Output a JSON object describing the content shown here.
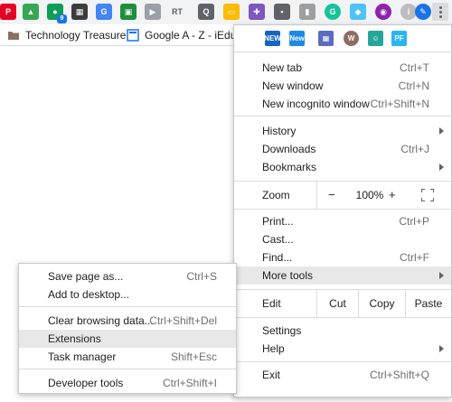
{
  "toolbar": {
    "extensions": [
      {
        "icon": "pinterest-icon",
        "color": "#e60023",
        "glyph": "P"
      },
      {
        "icon": "google-drive-icon",
        "color": "#34a853",
        "glyph": "▲"
      },
      {
        "icon": "hangouts-icon",
        "color": "#0f9d58",
        "glyph": "●",
        "badge": "9"
      },
      {
        "icon": "film-icon",
        "color": "#3c3c3c",
        "glyph": "▦"
      },
      {
        "icon": "google-translate-icon",
        "color": "#4285f4",
        "glyph": "G"
      },
      {
        "icon": "google-classroom-icon",
        "color": "#1e8e3e",
        "glyph": "▣"
      },
      {
        "icon": "screencast-play-icon",
        "color": "#9aa0a6",
        "glyph": "▶"
      },
      {
        "icon": "rt-icon",
        "color": "#9aa0a6",
        "glyph": "RT"
      },
      {
        "icon": "lens-icon",
        "color": "#5f6368",
        "glyph": "Q"
      },
      {
        "icon": "comment-icon",
        "color": "#fbbc04",
        "glyph": "▭"
      },
      {
        "icon": "puzzle-icon",
        "color": "#7e57c2",
        "glyph": "✚"
      },
      {
        "icon": "notes-icon",
        "color": "#5f6368",
        "glyph": "▪"
      },
      {
        "icon": "keep-icon",
        "color": "#9e9e9e",
        "glyph": "▮"
      },
      {
        "icon": "grammarly-icon",
        "color": "#15c39a",
        "glyph": "G"
      },
      {
        "icon": "diamond-icon",
        "color": "#4fc3f7",
        "glyph": "◆"
      },
      {
        "icon": "avatar-icon",
        "color": "#8e24aa",
        "glyph": "◉"
      },
      {
        "icon": "info-icon",
        "color": "#bdbdbd",
        "glyph": "i"
      },
      {
        "icon": "edit-icon",
        "color": "#1a73e8",
        "glyph": "✎"
      }
    ]
  },
  "bookmarks": [
    {
      "label": "Technology Treasure",
      "icon": "folder-icon"
    },
    {
      "label": "Google A - Z - iEduc",
      "icon": "bookmark-page-icon"
    }
  ],
  "menu": {
    "extensions": [
      {
        "icon": "new-ext-icon",
        "color": "#1565c0",
        "glyph": "NEW"
      },
      {
        "icon": "new-badge-icon",
        "color": "#1e88e5",
        "glyph": "New"
      },
      {
        "icon": "pattern-icon",
        "color": "#5c6bc0",
        "glyph": "▦"
      },
      {
        "icon": "w-circle-icon",
        "color": "#8d6e63",
        "glyph": "W"
      },
      {
        "icon": "chat-square-icon",
        "color": "#26a69a",
        "glyph": "☺"
      },
      {
        "icon": "pdf-icon",
        "color": "#29b6f6",
        "glyph": "PF"
      }
    ],
    "new_tab": {
      "label": "New tab",
      "shortcut": "Ctrl+T"
    },
    "new_window": {
      "label": "New window",
      "shortcut": "Ctrl+N"
    },
    "new_incognito": {
      "label": "New incognito window",
      "shortcut": "Ctrl+Shift+N"
    },
    "history": {
      "label": "History"
    },
    "downloads": {
      "label": "Downloads",
      "shortcut": "Ctrl+J"
    },
    "bookmarks": {
      "label": "Bookmarks"
    },
    "zoom": {
      "label": "Zoom",
      "minus": "−",
      "value": "100%",
      "plus": "+"
    },
    "print": {
      "label": "Print...",
      "shortcut": "Ctrl+P"
    },
    "cast": {
      "label": "Cast..."
    },
    "find": {
      "label": "Find...",
      "shortcut": "Ctrl+F"
    },
    "more_tools": {
      "label": "More tools"
    },
    "edit": {
      "label": "Edit",
      "cut": "Cut",
      "copy": "Copy",
      "paste": "Paste"
    },
    "settings": {
      "label": "Settings"
    },
    "help": {
      "label": "Help"
    },
    "exit": {
      "label": "Exit",
      "shortcut": "Ctrl+Shift+Q"
    }
  },
  "submenu": {
    "save_page": {
      "label": "Save page as...",
      "shortcut": "Ctrl+S"
    },
    "add_desktop": {
      "label": "Add to desktop..."
    },
    "clear_data": {
      "label": "Clear browsing data...",
      "shortcut": "Ctrl+Shift+Del"
    },
    "extensions": {
      "label": "Extensions"
    },
    "task_manager": {
      "label": "Task manager",
      "shortcut": "Shift+Esc"
    },
    "dev_tools": {
      "label": "Developer tools",
      "shortcut": "Ctrl+Shift+I"
    }
  }
}
